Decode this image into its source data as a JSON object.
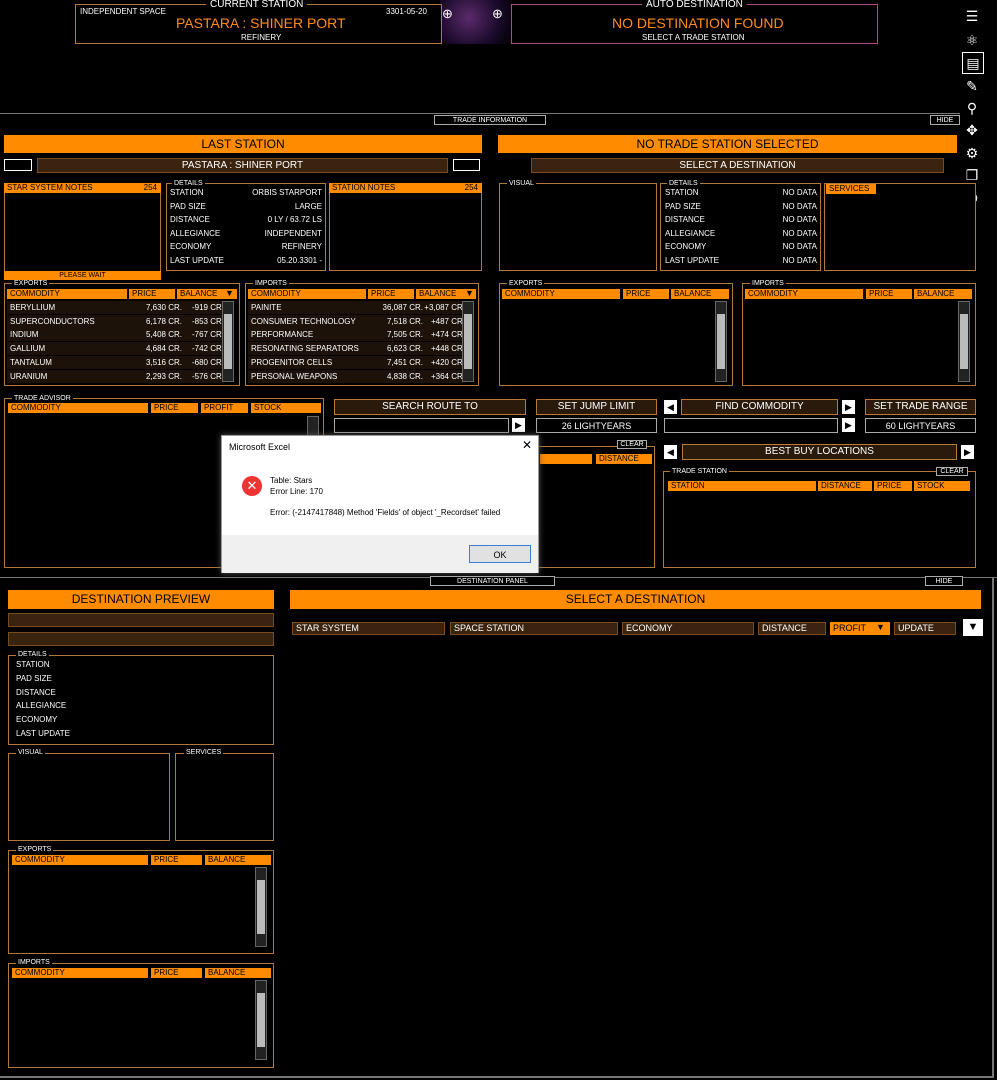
{
  "top": {
    "current_station_label": "CURRENT STATION",
    "space": "INDEPENDENT SPACE",
    "date": "3301-05-20",
    "station_name": "PASTARA : SHINER PORT",
    "economy": "REFINERY",
    "auto_dest_label": "AUTO DESTINATION",
    "no_destination": "NO DESTINATION FOUND",
    "select_trade_station": "SELECT A TRADE STATION"
  },
  "trade_info_tab": "TRADE INFORMATION",
  "hide_label": "HIDE",
  "last_station": {
    "title": "LAST STATION",
    "name": "PASTARA : SHINER PORT",
    "star_notes_label": "STAR SYSTEM NOTES",
    "star_notes_count": "254",
    "please_wait": "PLEASE WAIT",
    "details_label": "DETAILS",
    "details": [
      {
        "k": "STATION",
        "v": "ORBIS STARPORT"
      },
      {
        "k": "PAD SIZE",
        "v": "LARGE"
      },
      {
        "k": "DISTANCE",
        "v": "0 LY / 63.72 LS"
      },
      {
        "k": "ALLEGIANCE",
        "v": "INDEPENDENT"
      },
      {
        "k": "ECONOMY",
        "v": "REFINERY"
      },
      {
        "k": "LAST UPDATE",
        "v": "05.20.3301 -"
      }
    ],
    "station_notes_label": "STATION NOTES",
    "station_notes_count": "254",
    "exports_label": "EXPORTS",
    "imports_label": "IMPORTS",
    "cols": [
      "COMMODITY",
      "PRICE",
      "BALANCE"
    ],
    "exports": [
      {
        "c": "BERYLLIUM",
        "p": "7,630 CR.",
        "b": "-919 CR."
      },
      {
        "c": "SUPERCONDUCTORS",
        "p": "6,178 CR.",
        "b": "-853 CR."
      },
      {
        "c": "INDIUM",
        "p": "5,408 CR.",
        "b": "-767 CR."
      },
      {
        "c": "GALLIUM",
        "p": "4,684 CR.",
        "b": "-742 CR."
      },
      {
        "c": "TANTALUM",
        "p": "3,516 CR.",
        "b": "-680 CR."
      },
      {
        "c": "URANIUM",
        "p": "2,293 CR.",
        "b": "-576 CR."
      }
    ],
    "imports": [
      {
        "c": "PAINITE",
        "p": "36,087 CR.",
        "b": "+3,087 CR."
      },
      {
        "c": "CONSUMER TECHNOLOGY",
        "p": "7,518 CR.",
        "b": "+487 CR."
      },
      {
        "c": "PERFORMANCE ENHANCERS",
        "p": "7,505 CR.",
        "b": "+474 CR."
      },
      {
        "c": "RESONATING SEPARATORS",
        "p": "6,623 CR.",
        "b": "+448 CR."
      },
      {
        "c": "PROGENITOR CELLS",
        "p": "7,451 CR.",
        "b": "+420 CR."
      },
      {
        "c": "PERSONAL WEAPONS",
        "p": "4,838 CR.",
        "b": "+364 CR."
      }
    ]
  },
  "no_trade": {
    "title": "NO TRADE STATION SELECTED",
    "select_dest": "SELECT A DESTINATION",
    "visual_label": "VISUAL",
    "details_label": "DETAILS",
    "services_label": "SERVICES",
    "details": [
      {
        "k": "STATION",
        "v": "NO DATA"
      },
      {
        "k": "PAD SIZE",
        "v": "NO DATA"
      },
      {
        "k": "DISTANCE",
        "v": "NO DATA"
      },
      {
        "k": "ALLEGIANCE",
        "v": "NO DATA"
      },
      {
        "k": "ECONOMY",
        "v": "NO DATA"
      },
      {
        "k": "LAST UPDATE",
        "v": "NO DATA"
      }
    ],
    "exports_label": "EXPORTS",
    "imports_label": "IMPORTS"
  },
  "trade_advisor": {
    "label": "TRADE ADVISOR",
    "cols": [
      "COMMODITY",
      "PRICE",
      "PROFIT",
      "STOCK"
    ]
  },
  "controls": {
    "search_route": "SEARCH ROUTE TO",
    "set_jump_limit": "SET JUMP LIMIT",
    "jump_value": "26 LIGHTYEARS",
    "find_commodity": "FIND COMMODITY",
    "set_trade_range": "SET TRADE RANGE",
    "range_value": "60 LIGHTYEARS",
    "clear": "CLEAR",
    "distance": "DISTANCE",
    "best_buy": "BEST BUY LOCATIONS",
    "trade_station_label": "TRADE STATION",
    "best_cols": [
      "STATION",
      "DISTANCE",
      "PRICE",
      "STOCK"
    ]
  },
  "dialog": {
    "title": "Microsoft Excel",
    "line1": "Table: Stars",
    "line2": "Error Line: 170",
    "line3": "Error: (-2147417848) Method 'Fields' of object '_Recordset' failed",
    "ok": "OK"
  },
  "dest_panel_tab": "DESTINATION PANEL",
  "dest_preview": {
    "title": "DESTINATION PREVIEW",
    "details_label": "DETAILS",
    "details": [
      "STATION",
      "PAD SIZE",
      "DISTANCE",
      "ALLEGIANCE",
      "ECONOMY",
      "LAST UPDATE"
    ],
    "visual_label": "VISUAL",
    "services_label": "SERVICES",
    "exports_label": "EXPORTS",
    "imports_label": "IMPORTS",
    "cols": [
      "COMMODITY",
      "PRICE",
      "BALANCE"
    ]
  },
  "select_dest": {
    "title": "SELECT A DESTINATION",
    "cols": [
      "STAR SYSTEM",
      "SPACE STATION",
      "ECONOMY",
      "DISTANCE",
      "PROFIT",
      "UPDATE"
    ]
  },
  "colors": {
    "accent": "#ff8c00",
    "bg": "#000000",
    "border": "#b07a3a"
  }
}
